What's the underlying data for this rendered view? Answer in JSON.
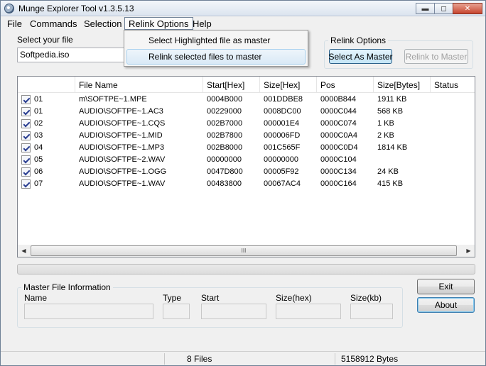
{
  "window": {
    "title": "Munge Explorer Tool v1.3.5.13"
  },
  "caption": {
    "minimize": "▬",
    "maximize": "◻",
    "close": "✕"
  },
  "menu": [
    "File",
    "Commands",
    "Selection",
    "Relink Options",
    "Help"
  ],
  "dropdown": {
    "items": [
      "Select Highlighted file as master",
      "Relink selected files to master"
    ],
    "hovered_index": 1
  },
  "file_select": {
    "label": "Select your file",
    "value": "Softpedia.iso"
  },
  "relink_options": {
    "title": "Relink Options",
    "select_as_master": "Select As Master",
    "relink_to_master": "Relink to Master"
  },
  "table": {
    "columns": [
      "",
      "File Name",
      "Start[Hex]",
      "Size[Hex]",
      "Pos",
      "Size[Bytes]",
      "Status"
    ],
    "rows": [
      {
        "checked": true,
        "id": "01",
        "name": "m\\SOFTPE~1.MPE",
        "start": "0004B000",
        "size_hex": "001DDBE8",
        "pos": "0000B844",
        "bytes": "1911 KB",
        "status": ""
      },
      {
        "checked": true,
        "id": "01",
        "name": "AUDIO\\SOFTPE~1.AC3",
        "start": "00229000",
        "size_hex": "0008DC00",
        "pos": "0000C044",
        "bytes": "568 KB",
        "status": ""
      },
      {
        "checked": true,
        "id": "02",
        "name": "AUDIO\\SOFTPE~1.CQS",
        "start": "002B7000",
        "size_hex": "000001E4",
        "pos": "0000C074",
        "bytes": "1 KB",
        "status": ""
      },
      {
        "checked": true,
        "id": "03",
        "name": "AUDIO\\SOFTPE~1.MID",
        "start": "002B7800",
        "size_hex": "000006FD",
        "pos": "0000C0A4",
        "bytes": "2 KB",
        "status": ""
      },
      {
        "checked": true,
        "id": "04",
        "name": "AUDIO\\SOFTPE~1.MP3",
        "start": "002B8000",
        "size_hex": "001C565F",
        "pos": "0000C0D4",
        "bytes": "1814 KB",
        "status": ""
      },
      {
        "checked": true,
        "id": "05",
        "name": "AUDIO\\SOFTPE~2.WAV",
        "start": "00000000",
        "size_hex": "00000000",
        "pos": "0000C104",
        "bytes": "",
        "status": ""
      },
      {
        "checked": true,
        "id": "06",
        "name": "AUDIO\\SOFTPE~1.OGG",
        "start": "0047D800",
        "size_hex": "00005F92",
        "pos": "0000C134",
        "bytes": "24 KB",
        "status": ""
      },
      {
        "checked": true,
        "id": "07",
        "name": "AUDIO\\SOFTPE~1.WAV",
        "start": "00483800",
        "size_hex": "00067AC4",
        "pos": "0000C164",
        "bytes": "415 KB",
        "status": ""
      }
    ],
    "scroll": {
      "left": "◀",
      "right": "▶",
      "grip": "III"
    }
  },
  "progress": {
    "value": 0
  },
  "master_info": {
    "title": "Master File Information",
    "labels": {
      "name": "Name",
      "type": "Type",
      "start": "Start",
      "size_hex": "Size(hex)",
      "size_kb": "Size(kb)"
    },
    "values": {
      "name": "",
      "type": "",
      "start": "",
      "size_hex": "",
      "size_kb": ""
    }
  },
  "buttons": {
    "exit": "Exit",
    "about": "About"
  },
  "status": {
    "files": "8 Files",
    "bytes": "5158912 Bytes"
  }
}
